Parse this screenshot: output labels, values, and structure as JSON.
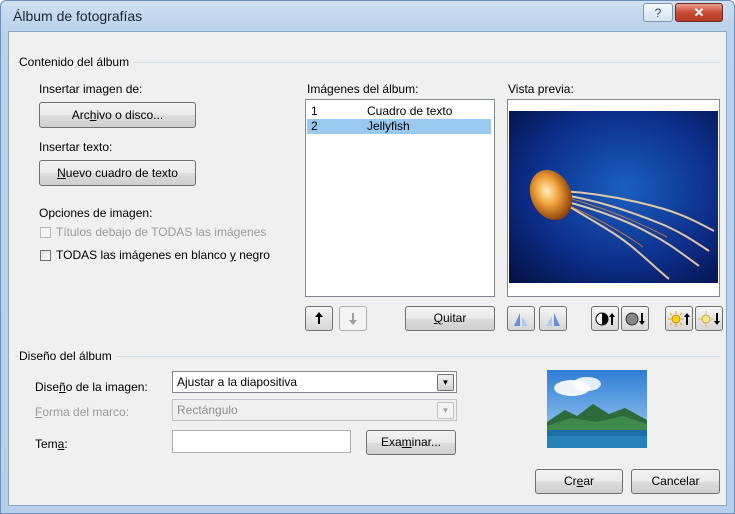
{
  "window": {
    "title": "Álbum de fotografías",
    "help_icon": "help-icon",
    "close_icon": "close-icon"
  },
  "album_content": {
    "group_label": "Contenido del álbum",
    "insert_image_label": "Insertar imagen de:",
    "file_button": {
      "pre": "Arc",
      "acc": "h",
      "post": "ivo o disco..."
    },
    "insert_text_label": "Insertar texto:",
    "new_textbox_button": {
      "pre": "",
      "acc": "N",
      "post": "uevo cuadro de texto"
    },
    "image_options_label": "Opciones de imagen:",
    "captions_option": "Títulos debajo de TODAS las imágenes",
    "bw_option": {
      "pre": "TODAS las imágenes en blanco ",
      "acc": "y",
      "post": " negro"
    },
    "album_images_label": {
      "pre": "Imá",
      "acc": "g",
      "post": "enes del álbum:"
    },
    "album_images": [
      {
        "num": "1",
        "name": "Cuadro de texto",
        "selected": false
      },
      {
        "num": "2",
        "name": "Jellyfish",
        "selected": true
      }
    ],
    "move_up_icon": "arrow-up-icon",
    "move_down_icon": "arrow-down-icon",
    "remove_button": {
      "pre": "",
      "acc": "Q",
      "post": "uitar"
    },
    "preview_label": "Vista previa:",
    "preview_tools": [
      "rotate-left-icon",
      "rotate-right-icon",
      "contrast-up-icon",
      "contrast-down-icon",
      "brightness-up-icon",
      "brightness-down-icon"
    ]
  },
  "album_layout": {
    "group_label": "Diseño del álbum",
    "picture_layout_label": {
      "pre": "Dise",
      "acc": "ñ",
      "post": "o de la imagen:"
    },
    "picture_layout_value": "Ajustar a la diapositiva",
    "frame_shape_label": {
      "pre": "",
      "acc": "F",
      "post": "orma del marco:"
    },
    "frame_shape_value": "Rectángulo",
    "theme_label": {
      "pre": "Tem",
      "acc": "a",
      "post": ":"
    },
    "theme_value": "",
    "browse_button": {
      "pre": "Exa",
      "acc": "m",
      "post": "inar..."
    }
  },
  "footer": {
    "create_button": {
      "pre": "Cr",
      "acc": "e",
      "post": "ar"
    },
    "cancel_button": "Cancelar"
  },
  "colors": {
    "selection": "#99c9ef",
    "dialog_bg": "#f0f0f0",
    "title_bar": "#bcd3ec",
    "close_button": "#c84c33"
  }
}
